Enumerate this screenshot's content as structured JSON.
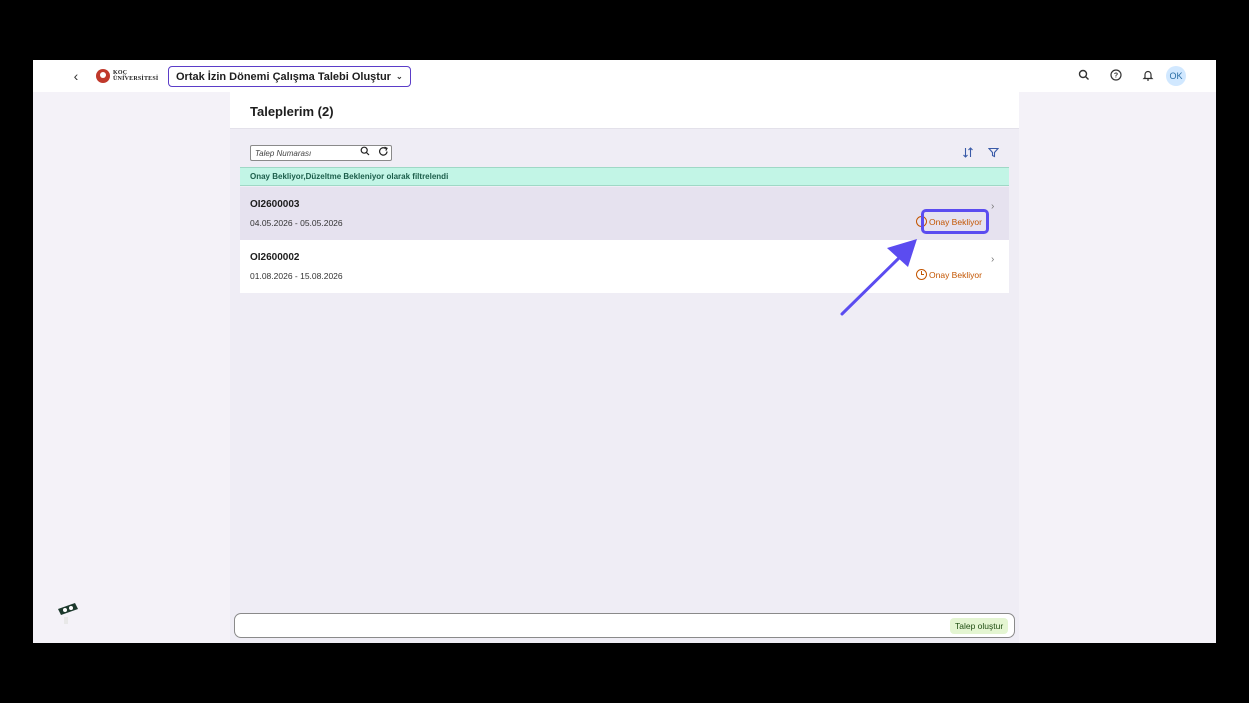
{
  "shellbar": {
    "app_title": "Ortak İzin Dönemi Çalışma Talebi Oluştur",
    "logo_line1": "KOÇ",
    "logo_line2": "ÜNİVERSİTESİ",
    "avatar_initials": "OK"
  },
  "page": {
    "title": "Taleplerim (2)"
  },
  "toolbar": {
    "search_placeholder": "Talep Numarası"
  },
  "filter_bar": {
    "text": "Onay Bekliyor,Düzeltme Bekleniyor olarak filtrelendi"
  },
  "requests": [
    {
      "id": "OI2600003",
      "dates": "04.05.2026 - 05.05.2026",
      "status": "Onay Bekliyor",
      "selected": true
    },
    {
      "id": "OI2600002",
      "dates": "01.08.2026 - 15.08.2026",
      "status": "Onay Bekliyor",
      "selected": false
    }
  ],
  "footer": {
    "create_label": "Talep oluştur"
  },
  "colors": {
    "brand": "#5b3dc8",
    "status_warning": "#c35500",
    "filter_bar_bg": "#c2f5e6",
    "annotation": "#5b4cf0"
  }
}
